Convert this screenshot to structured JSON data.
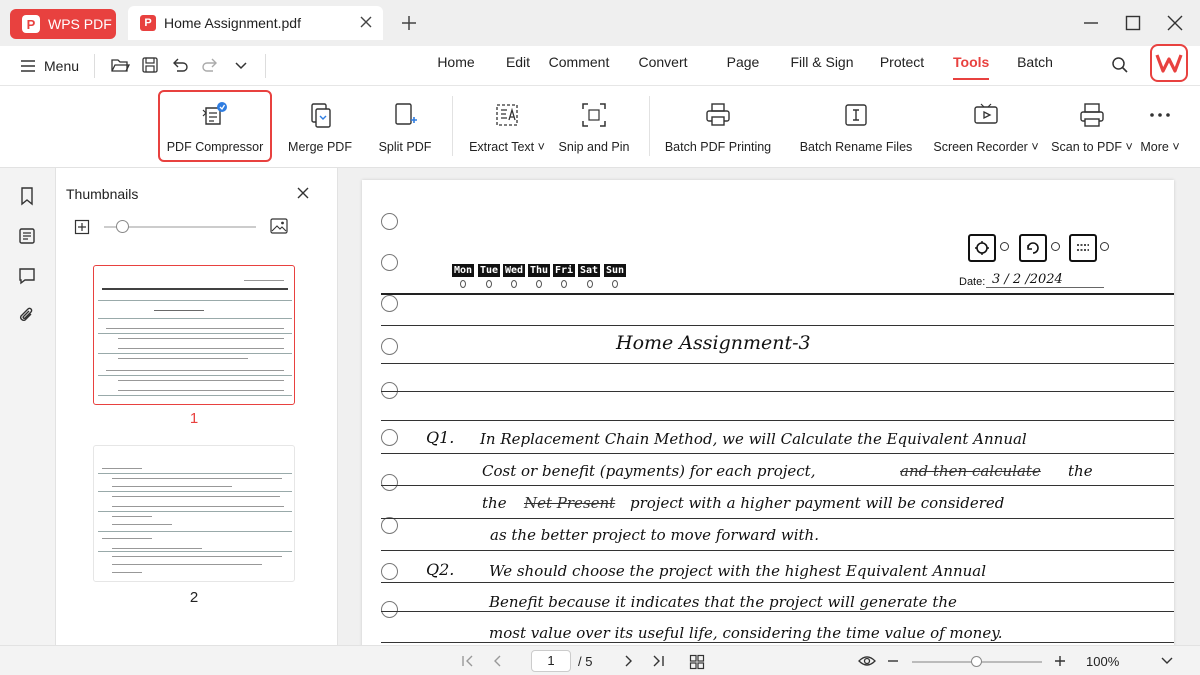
{
  "app": {
    "name": "WPS PDF",
    "badge": "P"
  },
  "document_tab": {
    "title": "Home Assignment.pdf",
    "badge": "P"
  },
  "menubar": {
    "menu_label": "Menu",
    "tabs": [
      "Home",
      "Edit",
      "Comment",
      "Convert",
      "Page",
      "Fill & Sign",
      "Protect",
      "Tools",
      "Batch"
    ],
    "active_tab": "Tools"
  },
  "ribbon": {
    "tools": [
      {
        "label": "PDF Compressor",
        "icon": "compress-icon",
        "highlighted": true
      },
      {
        "label": "Merge PDF",
        "icon": "merge-icon"
      },
      {
        "label": "Split PDF",
        "icon": "split-icon"
      },
      {
        "label": "Extract Text",
        "icon": "extract-text-icon",
        "dropdown": true
      },
      {
        "label": "Snip and Pin",
        "icon": "snip-icon"
      },
      {
        "label": "Batch PDF Printing",
        "icon": "printer-icon"
      },
      {
        "label": "Batch Rename Files",
        "icon": "rename-icon"
      },
      {
        "label": "Screen Recorder",
        "icon": "screen-recorder-icon",
        "dropdown": true
      },
      {
        "label": "Scan to PDF",
        "icon": "scanner-icon",
        "dropdown": true
      },
      {
        "label": "More",
        "icon": "more-icon",
        "dropdown": true
      }
    ]
  },
  "thumbnails": {
    "title": "Thumbnails",
    "pages": [
      {
        "number": "1",
        "selected": true
      },
      {
        "number": "2",
        "selected": false
      }
    ]
  },
  "document": {
    "days": [
      "Mon",
      "Tue",
      "Wed",
      "Thu",
      "Fri",
      "Sat",
      "Sun"
    ],
    "date_label": "Date:",
    "date_value": "3  /  2  /2024",
    "title": "Home Assignment-3",
    "q1_label": "Q1.",
    "q1_lines": [
      "In  Replacement  Chain  Method,  we  will  Calculate  the  Equivalent  Annual",
      "Cost  or  benefit (payments)  for  each  project,",
      "the",
      "project  with  a  higher  payment  will  be  considered",
      "as  the  better  project  to  move  forward  with."
    ],
    "q1_strike": [
      "and  then  calculate",
      "Net  Present"
    ],
    "q1_tail": "the",
    "q2_label": "Q2.",
    "q2_lines": [
      "We  should  choose  the  project  with  the  highest  Equivalent  Annual",
      "Benefit  because  it  indicates  that  the  project  will  generate  the",
      "most  value  over  its  useful  life,  considering  the  time  value  of  money."
    ]
  },
  "statusbar": {
    "current_page": "1",
    "total_pages": "/ 5",
    "zoom": "100%",
    "zoom_fraction": 0.5
  },
  "colors": {
    "accent": "#e8413f"
  }
}
